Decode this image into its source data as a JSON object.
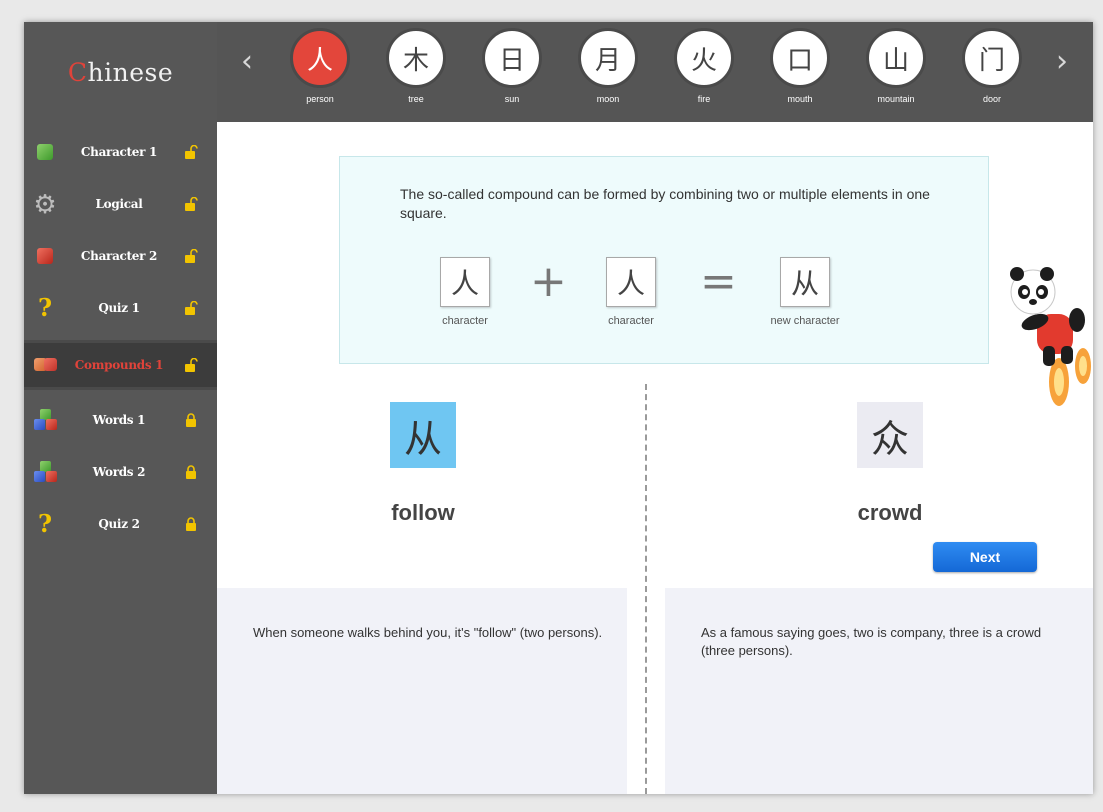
{
  "app": {
    "logo_first_letter": "C",
    "logo_rest": "hinese"
  },
  "sidebar": {
    "items": [
      {
        "label": "Character 1",
        "icon": "green-cube-icon",
        "active": false
      },
      {
        "label": "Logical",
        "icon": "gear-icon",
        "active": false
      },
      {
        "label": "Character 2",
        "icon": "red-cube-icon",
        "active": false
      },
      {
        "label": "Quiz 1",
        "icon": "question-mark-icon",
        "active": false
      },
      {
        "label": "Compounds 1",
        "icon": "double-cube-icon",
        "active": true
      },
      {
        "label": "Words 1",
        "icon": "blocks-icon",
        "active": false
      },
      {
        "label": "Words 2",
        "icon": "blocks-icon",
        "active": false
      },
      {
        "label": "Quiz 2",
        "icon": "question-mark-icon",
        "active": false
      }
    ]
  },
  "characters": [
    {
      "glyph": "人",
      "label": "person",
      "active": true
    },
    {
      "glyph": "木",
      "label": "tree",
      "active": false
    },
    {
      "glyph": "日",
      "label": "sun",
      "active": false
    },
    {
      "glyph": "月",
      "label": "moon",
      "active": false
    },
    {
      "glyph": "火",
      "label": "fire",
      "active": false
    },
    {
      "glyph": "口",
      "label": "mouth",
      "active": false
    },
    {
      "glyph": "山",
      "label": "mountain",
      "active": false
    },
    {
      "glyph": "门",
      "label": "door",
      "active": false
    }
  ],
  "info": {
    "text": "The so-called compound can be formed by combining two or multiple elements in one square.",
    "equation": {
      "first": {
        "glyph": "人",
        "caption": "character"
      },
      "plus": "+",
      "second": {
        "glyph": "人",
        "caption": "character"
      },
      "equals": "=",
      "result": {
        "glyph": "从",
        "caption": "new character"
      }
    }
  },
  "compounds": {
    "left": {
      "glyph": "从",
      "meaning": "follow",
      "description": "When someone walks behind you, it's \"follow\" (two persons)."
    },
    "right": {
      "glyph": "众",
      "meaning": "crowd",
      "description": "As a famous saying goes, two is company, three is a crowd (three persons)."
    }
  },
  "buttons": {
    "next": "Next"
  },
  "colors": {
    "accent_red": "#e3463b",
    "sidebar_bg": "#575757",
    "next_blue": "#1f78e6",
    "highlight_blue": "#6fc6f2"
  }
}
